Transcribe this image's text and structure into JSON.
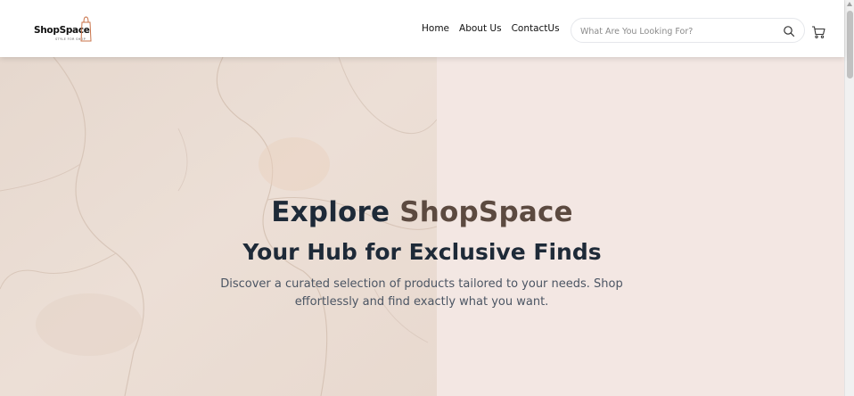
{
  "header": {
    "logo": {
      "name": "ShopSpace",
      "tagline": "STYLE FOR SHOP"
    },
    "nav": [
      {
        "label": "Home"
      },
      {
        "label": "About Us"
      },
      {
        "label": "ContactUs"
      }
    ],
    "search": {
      "placeholder": "What Are You Looking For?",
      "value": ""
    },
    "icons": {
      "search": "search-icon",
      "cart": "cart-icon"
    }
  },
  "hero": {
    "title_prefix": "Explore ",
    "title_brand": "ShopSpace",
    "subtitle": "Your Hub for Exclusive Finds",
    "description": "Discover a curated selection of products tailored to your needs. Shop effortlessly and find exactly what you want."
  },
  "colors": {
    "heading": "#1e2a38",
    "brand_accent": "#5c4a40",
    "hero_bg": "#f3e7e3",
    "logo_bag": "#c9734a"
  }
}
